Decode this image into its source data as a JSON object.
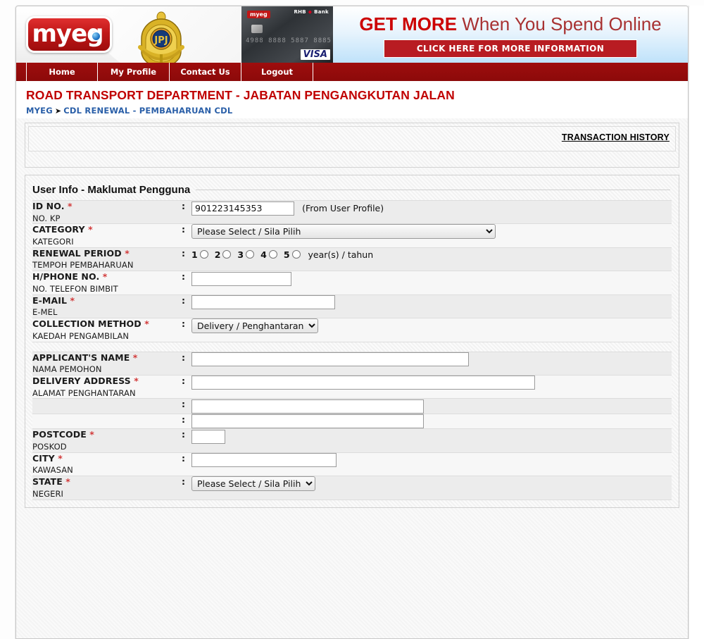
{
  "header": {
    "logo_text": "myeg",
    "emblem_name": "jpj-emblem",
    "card": {
      "bank_label": "RHB Bank",
      "brand_mini": "myeg",
      "digits": "4988 8888 5887 8885",
      "network": "VISA"
    },
    "promo": {
      "headline_strong": "GET MORE",
      "headline_light": "When You Spend Online",
      "button_label": "CLICK HERE FOR MORE INFORMATION"
    }
  },
  "nav": {
    "items": [
      {
        "label": "Home"
      },
      {
        "label": "My Profile"
      },
      {
        "label": "Contact Us"
      },
      {
        "label": "Logout"
      }
    ]
  },
  "page": {
    "title": "ROAD TRANSPORT DEPARTMENT - JABATAN PENGANGKUTAN JALAN",
    "breadcrumb_root": "MYEG",
    "breadcrumb_arrow": "➤",
    "breadcrumb_current": "CDL RENEWAL - PEMBAHARUAN CDL",
    "transaction_history": "TRANSACTION HISTORY"
  },
  "section": {
    "legend": "User Info - Maklumat Pengguna"
  },
  "colon": ":",
  "form": {
    "id_no": {
      "label_en": "ID NO.",
      "label_ms": "NO. KP",
      "required": "*",
      "value": "901223145353",
      "placeholder": "",
      "hint": "(From User Profile)"
    },
    "category": {
      "label_en": "CATEGORY",
      "label_ms": "KATEGORI",
      "required": "*",
      "selected": "Please Select / Sila Pilih"
    },
    "renewal_period": {
      "label_en": "RENEWAL PERIOD",
      "label_ms": "TEMPOH PEMBAHARUAN",
      "required": "*",
      "options": [
        "1",
        "2",
        "3",
        "4",
        "5"
      ],
      "suffix": "year(s) / tahun"
    },
    "hphone": {
      "label_en": "H/PHONE NO.",
      "label_ms": "NO. TELEFON BIMBIT",
      "required": "*",
      "value": "",
      "placeholder": ""
    },
    "email": {
      "label_en": "E-MAIL",
      "label_ms": "E-MEL",
      "required": "*",
      "value": "",
      "placeholder": ""
    },
    "collection_method": {
      "label_en": "COLLECTION METHOD",
      "label_ms": "KAEDAH PENGAMBILAN",
      "required": "*",
      "selected": "Delivery / Penghantaran"
    },
    "applicant_name": {
      "label_en": "APPLICANT'S NAME",
      "label_ms": "NAMA PEMOHON",
      "required": "*",
      "value": "",
      "placeholder": ""
    },
    "delivery_address": {
      "label_en": "DELIVERY ADDRESS",
      "label_ms": "ALAMAT PENGHANTARAN",
      "required": "*",
      "value": "",
      "placeholder": ""
    },
    "address_line2": {
      "value": "",
      "placeholder": ""
    },
    "address_line3": {
      "value": "",
      "placeholder": ""
    },
    "postcode": {
      "label_en": "POSTCODE",
      "label_ms": "POSKOD",
      "required": "*",
      "value": "",
      "placeholder": ""
    },
    "city": {
      "label_en": "CITY",
      "label_ms": "KAWASAN",
      "required": "*",
      "value": "",
      "placeholder": ""
    },
    "state": {
      "label_en": "STATE",
      "label_ms": "NEGERI",
      "required": "*",
      "selected": "Please Select / Sila Pilih"
    }
  },
  "colors": {
    "brand_red": "#9e0d0d",
    "title_red": "#c00000",
    "link_blue": "#2a5fa8",
    "required_red": "#d23a3a"
  }
}
